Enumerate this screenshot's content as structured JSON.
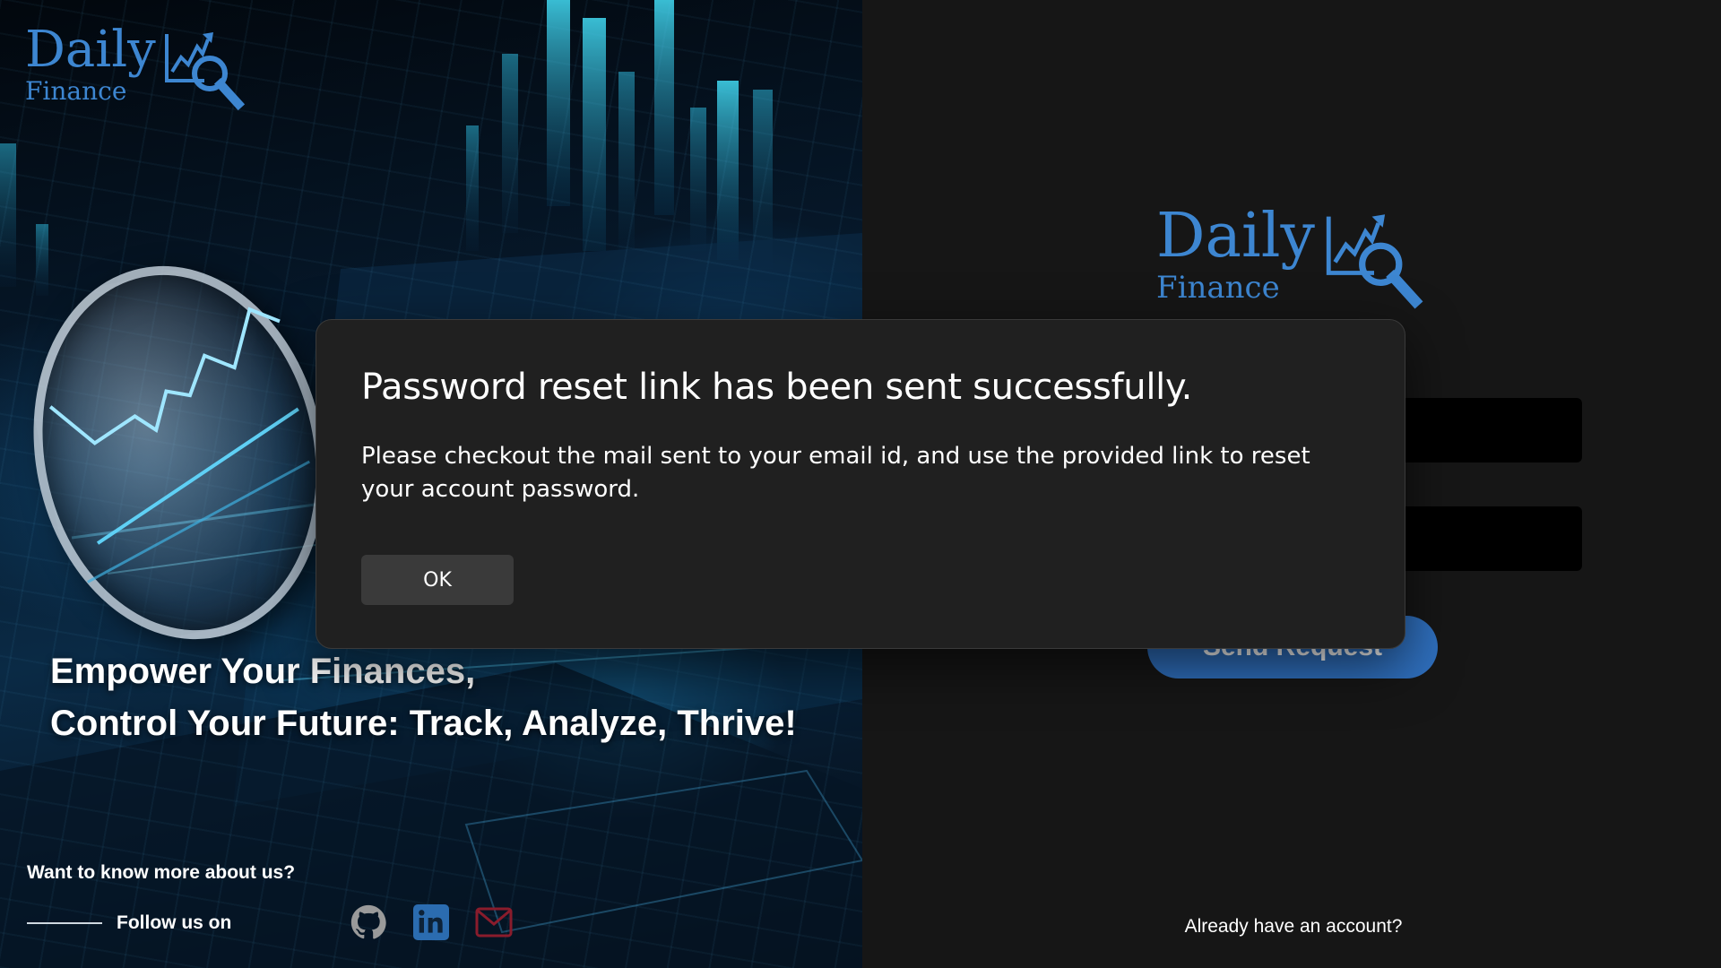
{
  "brand": {
    "name": "Daily",
    "subtitle": "Finance",
    "color": "#3d86d1"
  },
  "hero": {
    "tagline_line1": "Empower Your Finances,",
    "tagline_line2": "Control Your Future: Track, Analyze, Thrive!",
    "know_more": "Want to know more about us?",
    "follow_label": "Follow us on",
    "social": [
      {
        "icon": "github-icon",
        "color": "#9a9a9a"
      },
      {
        "icon": "linkedin-icon",
        "color": "#2b6cb0"
      },
      {
        "icon": "mail-icon",
        "color": "#8a1c2c"
      }
    ]
  },
  "form": {
    "send_button": "Send Request",
    "login_prompt": "Already have an account?",
    "accent": "#2f6fbd"
  },
  "dialog": {
    "title": "Password reset link has been sent successfully.",
    "message": "Please checkout the mail sent to your email id, and use the provided link to reset your account password.",
    "ok_label": "OK"
  }
}
